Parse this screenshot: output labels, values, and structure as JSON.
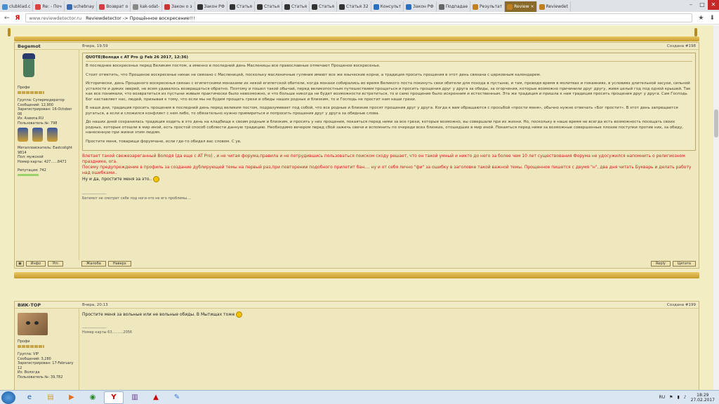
{
  "tabs": [
    {
      "label": "clubklad.c",
      "color": "#4a90d0"
    },
    {
      "label": "Re: - Поч",
      "color": "#e04040"
    },
    {
      "label": "uchebnay",
      "color": "#3a6ab0"
    },
    {
      "label": "Возврат о",
      "color": "#d04040"
    },
    {
      "label": "kak-sdat-",
      "color": "#888888"
    },
    {
      "label": "Закон о з",
      "color": "#cc3333"
    },
    {
      "label": "Закон РФ",
      "color": "#333333"
    },
    {
      "label": "Статья",
      "color": "#333333"
    },
    {
      "label": "Статья",
      "color": "#333333"
    },
    {
      "label": "Статья",
      "color": "#333333"
    },
    {
      "label": "Статья",
      "color": "#333333"
    },
    {
      "label": "Статья 32",
      "color": "#333333"
    },
    {
      "label": "Консульт",
      "color": "#2a70c0"
    },
    {
      "label": "Закон РФ",
      "color": "#2a70c0"
    },
    {
      "label": "Подпадае",
      "color": "#666666"
    },
    {
      "label": "Результат",
      "color": "#c08020"
    },
    {
      "label": "Review",
      "color": "#c08020",
      "active": true
    },
    {
      "label": "Reviewdet",
      "color": "#c08020"
    }
  ],
  "address": {
    "host": "www.reviewdetector.ru",
    "path": "Reviewdetector -> Прощённое воскресение!!!"
  },
  "post1": {
    "author": "Begemot",
    "date": "Вчера, 19:59",
    "created": "Создана #198",
    "profile": {
      "title": "Профи",
      "group": "Группа: Супермодератор",
      "posts": "Сообщений: 12,900",
      "registered": "Зарегистрирован: 16-October 06",
      "from": "Из: Азиопа.RU",
      "user_no": "Пользователь №: 798",
      "collector": "Металлоискатель: Eastcolight 9814",
      "gender": "Пол: мужской",
      "card": "Номер карты: 427......8471",
      "reputation": "Репутация: 742 "
    },
    "quote_title": "QUOTE(Володя с AT Pro @ Feb 26 2017, 12:36)",
    "quote": [
      "В последнее воскресенье перед Великим постом, а именно в последний день Масленицы все православные отмечают Прощеное воскресенье.",
      "Стоит отметить, что Прощеное воскресенье никак не связано с Масленицей, поскольку масленичные гуляния имеют все же языческие корни, а традиция просить прощения в этот день связана с церковным календарем.",
      "Исторически, день Прощеного воскресенья связан с египетскими монахами из некой египетской обители, когда монахи собирались во время Великого поста покинуть свои обители для похода в пустыню, и там, проводя время в молитвах и покаяниях, в условиях длительной засухи, сильной усталости и диких зверей, не всем удавалось возвращаться обратно. Поэтому и пошел такой обычай, перед великопостным путешествием прощаться и просить прощения друг у друга за обиды, за огорчения, которые возможно причинили друг другу, живя целый год под одной крышей. Так как все понимали, что возвратиться из пустыни живым практически было невозможно, и что больше никогда не будет возможности встретиться, то и само прощение было искренним и естественным. Эта же традиция и пришла к нам традиция просить прощения друг у друга. Сам Господь Бог наставляет нас, людей, призывая к тому, что если мы не будем прощать грехи и обиды наших родных и близким, то и Господь не простит нам наши грехи.",
      "В наши дни, традиция просить прощения в последний день перед великим постом, подразумевает под собой, что все родные и близкие  просят прощения друг у друга. Когда к вам обращаются с просьбой «прости меня», обычно нужно отвечать «Бог простит». В этот день запрещается ругаться, а если и сложился конфликт с кем либо, то обязательно нужно примириться и попросить прощения друг у друга за обидные слова.",
      "До наших дней сохранилась традиция ходить в это день на кладбище к своим родным и близким, и просить у них прощения, покаяться перед ними за все грехи, которые возможно, вы совершали при их жизни.  Но, поскольку в наше время не всегда есть возможность посещать своих родных, которые отошли в мир иной, есть простой способ соблюсти данную традицию. Необходимо вечером перед сбой зажечь свечи и вспомнить по очереди всех близких, отошедших в мир иной. Покаяться перед ними за возможные совершенные плохие поступки против них, за обиду, нанесенную при жизни этим людям.",
      "Простите меня, товарищи форумчане, если где-то обидел вас словом. С ув."
    ],
    "reply_red": [
      "Влетает такой свежезареганный Володя (да еще с AT Pro) , и не читая форума,правила и не потрудившись пользоваться поиском сходу решает, что он такой умный и никто до него за более чем 10 лет существования Форума не удосужился напомнить о религиозном празднике, ога.",
      "Посему предупреждение в профиль за создание дублирующей темы на первый раз,при повторении подобного прилетит бан.... ну и от себя лично \"фи\" за ошибку в заголовке такой важной темы. Прощенное пишется с двумя \"н\", два дня читать Букварь и делать работу над ошибками.."
    ],
    "reply_dark": "Ну и да, простите меня за это..",
    "sig_sep": "-------------------",
    "signature": "Бегемот не смотрит себе под ноги-это не его проблемы....",
    "buttons": {
      "info": "Инфо",
      "pm": "Pm",
      "complaint": "Жалоба",
      "top": "Наверх",
      "reply": "Reply",
      "quote": "Цитата"
    }
  },
  "post2": {
    "author": "ВИК-ТОР",
    "date": "Вчера, 20:13",
    "created": "Создана #199",
    "profile": {
      "title": "Профи",
      "group": "Группа: VIP",
      "posts": "Сообщений: 3,280",
      "registered": "Зарегистрирован: 17-February 12",
      "from": "Из: Вологда",
      "user_no": "Пользователь №: 39,782"
    },
    "text": "Простите меня за вольные или не вольные обиды. В Мытищах тоже",
    "sig_sep": "-------------------",
    "signature": "Номер карты 63..........2056"
  },
  "taskbar": {
    "lang": "RU",
    "time": "18:29",
    "date": "27.02.2017"
  }
}
